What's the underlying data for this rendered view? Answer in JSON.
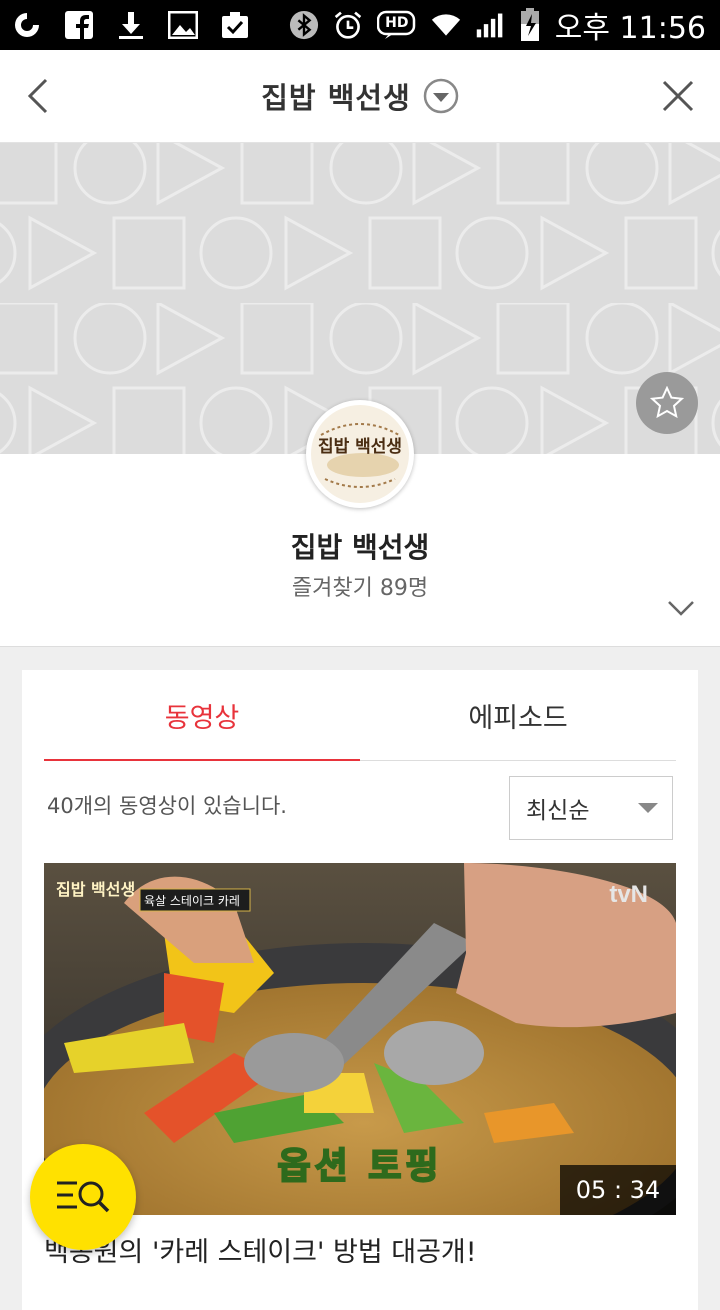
{
  "status_bar": {
    "time": "오후 11:56",
    "icons": [
      "o-app-icon",
      "facebook-icon",
      "download-icon",
      "gallery-icon",
      "clipboard-check-icon",
      "bluetooth-icon",
      "alarm-icon",
      "hd-icon",
      "wifi-icon",
      "signal-icon",
      "battery-charging-icon"
    ],
    "hd_label": "HD"
  },
  "header": {
    "title": "집밥 백선생"
  },
  "program": {
    "name": "집밥 백선생",
    "favorites": "즐겨찾기 89명",
    "logo_text": "집밥 백선생"
  },
  "tabs": [
    {
      "label": "동영상",
      "active": true
    },
    {
      "label": "에피소드",
      "active": false
    }
  ],
  "video_list": {
    "count_text": "40개의 동영상이 있습니다.",
    "sort_selected": "최신순",
    "videos": [
      {
        "title": "백종원의 '카레 스테이크' 방법 대공개!",
        "duration": "05 : 34",
        "thumbnail": {
          "caption": "옵션 토핑",
          "tag": "육살 스테이크 카레",
          "channel": "tvN",
          "logo_text": "집밥 백선생"
        }
      }
    ]
  },
  "colors": {
    "accent": "#e8333b",
    "fab": "#ffe100",
    "banner": "#dcdcdc"
  }
}
